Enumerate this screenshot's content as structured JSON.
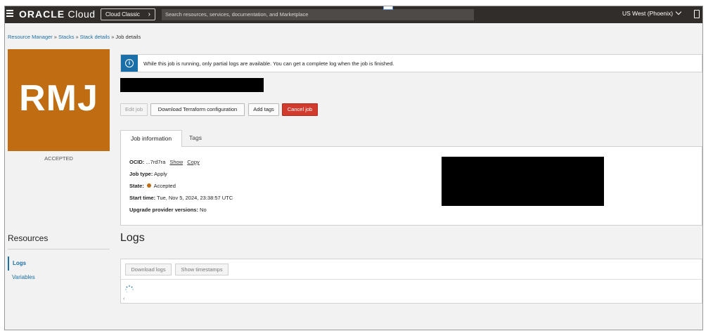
{
  "topbar": {
    "logo_brand": "ORACLE",
    "logo_product": "Cloud",
    "classic_button": "Cloud Classic",
    "search_placeholder": "Search resources, services, documentation, and Marketplace",
    "region": "US West (Phoenix)"
  },
  "breadcrumb": {
    "items": [
      "Resource Manager",
      "Stacks",
      "Stack details"
    ],
    "current": "Job details"
  },
  "job_tile": {
    "initials": "RMJ",
    "state_label": "ACCEPTED",
    "tile_color": "#c06c12"
  },
  "resources": {
    "title": "Resources",
    "items": [
      "Logs",
      "Variables"
    ],
    "active": "Logs"
  },
  "alert": {
    "text": "While this job is running, only partial logs are available. You can get a complete log when the job is finished."
  },
  "actions": {
    "edit_job": "Edit job",
    "download_tf": "Download Terraform configuration",
    "add_tags": "Add tags",
    "cancel_job": "Cancel job"
  },
  "tabs": {
    "job_information": "Job information",
    "tags": "Tags"
  },
  "job_info": {
    "ocid_label": "OCID:",
    "ocid_value": "...7rd7ra",
    "show_link": "Show",
    "copy_link": "Copy",
    "job_type_label": "Job type:",
    "job_type_value": "Apply",
    "state_label": "State:",
    "state_value": "Accepted",
    "state_color": "#c06c12",
    "start_time_label": "Start time:",
    "start_time_value": "Tue, Nov 5, 2024, 23:38:57 UTC",
    "upgrade_label": "Upgrade provider versions:",
    "upgrade_value": "No"
  },
  "logs": {
    "heading": "Logs",
    "download_logs": "Download logs",
    "show_timestamps": "Show timestamps"
  },
  "colors": {
    "topbar": "#312d2a",
    "link": "#1a6fa8",
    "danger": "#d13b2e"
  }
}
